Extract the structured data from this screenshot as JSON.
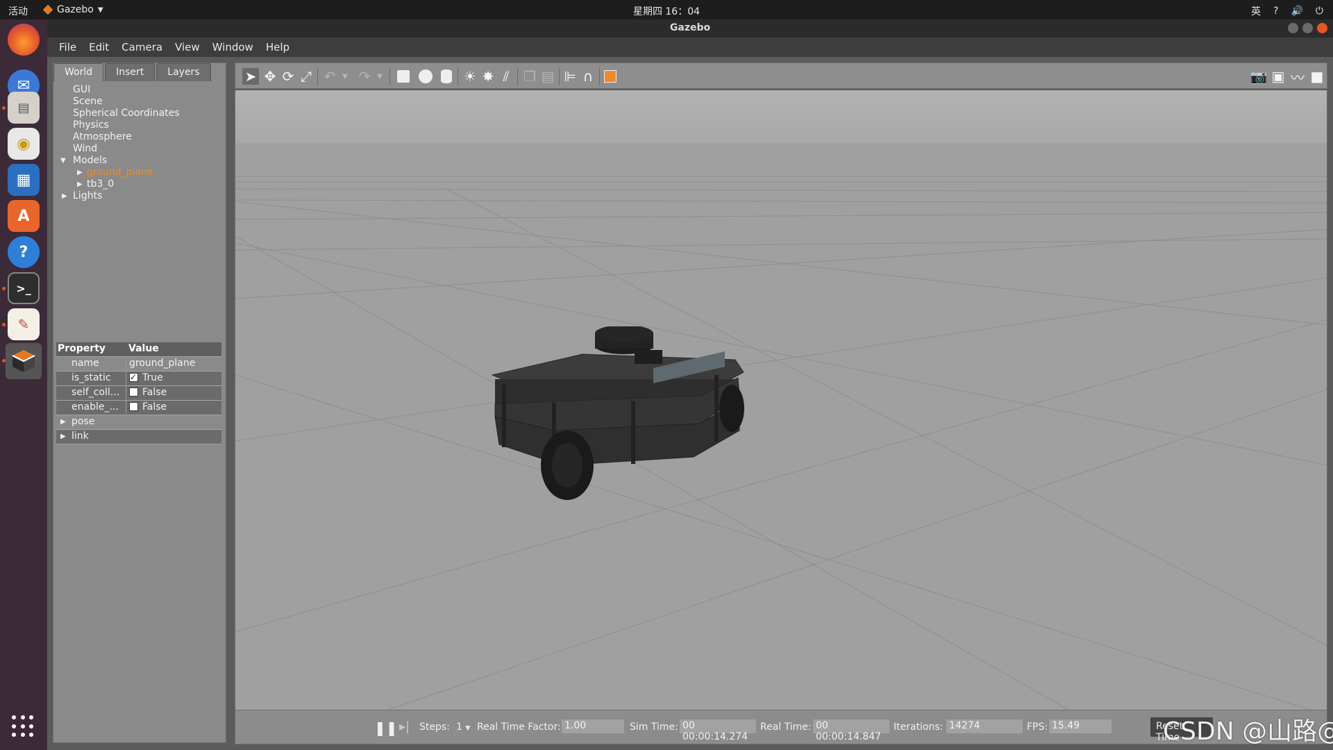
{
  "system_bar": {
    "activities": "活动",
    "app_menu": "Gazebo",
    "clock": "星期四 16：04",
    "input_method": "英",
    "tray_help": "?",
    "tray_volume": "🔊",
    "tray_power": "⏻"
  },
  "window": {
    "title": "Gazebo"
  },
  "menu": [
    "File",
    "Edit",
    "Camera",
    "View",
    "Window",
    "Help"
  ],
  "tabs": [
    "World",
    "Insert",
    "Layers"
  ],
  "tree": {
    "items": [
      "GUI",
      "Scene",
      "Spherical Coordinates",
      "Physics",
      "Atmosphere",
      "Wind"
    ],
    "models_label": "Models",
    "models": [
      "ground_plane",
      "tb3_0"
    ],
    "lights_label": "Lights"
  },
  "properties": {
    "header_property": "Property",
    "header_value": "Value",
    "rows": [
      {
        "name": "name",
        "value": "ground_plane"
      },
      {
        "name": "is_static",
        "value": "True",
        "checked": true
      },
      {
        "name": "self_coll...",
        "value": "False",
        "checked": false
      },
      {
        "name": "enable_...",
        "value": "False",
        "checked": false
      },
      {
        "name": "pose"
      },
      {
        "name": "link"
      }
    ]
  },
  "statusbar": {
    "steps_label": "Steps:",
    "steps_value": "1",
    "rtf_label": "Real Time Factor:",
    "rtf_value": "1.00",
    "sim_time_label": "Sim Time:",
    "sim_time_value": "00 00:00:14.274",
    "real_time_label": "Real Time:",
    "real_time_value": "00 00:00:14.847",
    "iterations_label": "Iterations:",
    "iterations_value": "14274",
    "fps_label": "FPS:",
    "fps_value": "15.49",
    "reset_label": "Reset Time"
  },
  "watermark": "CSDN @山路@",
  "colors": {
    "accent": "#f08a24",
    "ubuntu_orange": "#e95420"
  }
}
